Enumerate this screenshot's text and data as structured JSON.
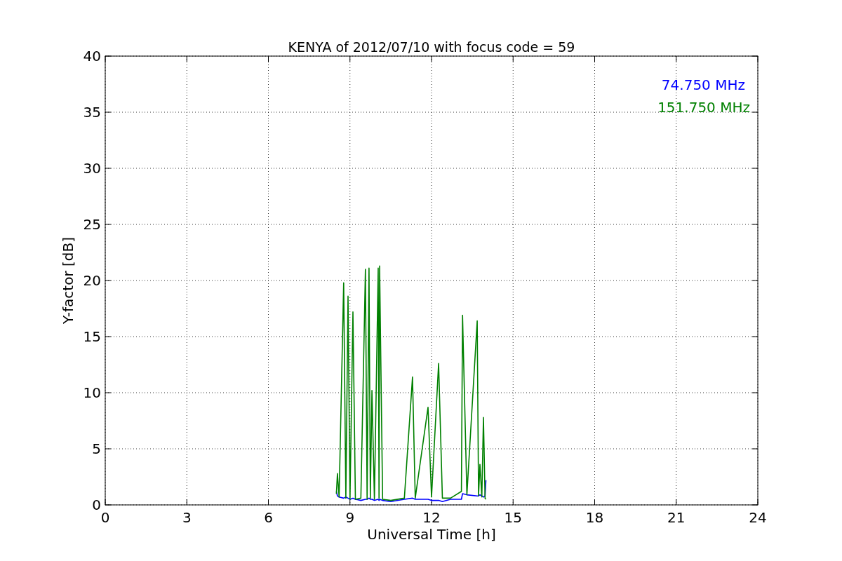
{
  "figure": {
    "chart_data": {
      "type": "line",
      "title": "KENYA of 2012/07/10 with focus code = 59",
      "xlabel": "Universal Time [h]",
      "ylabel": "Y-factor [dB]",
      "x": [
        8.5,
        8.54,
        8.6,
        8.77,
        8.85,
        8.93,
        9.0,
        9.11,
        9.2,
        9.4,
        9.57,
        9.63,
        9.7,
        9.75,
        9.81,
        9.9,
        10.04,
        10.07,
        10.09,
        10.2,
        10.5,
        11.0,
        11.3,
        11.4,
        11.87,
        12.0,
        12.26,
        12.4,
        12.7,
        13.1,
        13.14,
        13.3,
        13.68,
        13.73,
        13.78,
        13.85,
        13.91,
        13.97,
        14.0
      ],
      "series": [
        {
          "name": "74.750 MHz",
          "color": "#0000ff",
          "values": [
            1.2,
            0.8,
            0.7,
            0.6,
            0.7,
            0.6,
            0.5,
            0.6,
            0.5,
            0.4,
            0.5,
            0.5,
            0.6,
            0.5,
            0.5,
            0.4,
            0.5,
            0.4,
            0.5,
            0.4,
            0.3,
            0.5,
            0.6,
            0.5,
            0.5,
            0.4,
            0.4,
            0.3,
            0.5,
            0.5,
            1.0,
            0.9,
            0.8,
            0.8,
            0.9,
            0.8,
            0.7,
            0.8,
            2.2
          ]
        },
        {
          "name": "151.750 MHz",
          "color": "#008000",
          "values": [
            1.0,
            2.8,
            0.7,
            19.8,
            0.6,
            18.6,
            0.5,
            17.2,
            0.5,
            0.6,
            21.0,
            0.5,
            21.1,
            0.6,
            10.2,
            0.5,
            21.1,
            0.6,
            21.3,
            0.5,
            0.4,
            0.6,
            11.4,
            0.6,
            8.7,
            0.7,
            12.6,
            0.6,
            0.6,
            1.2,
            16.9,
            0.9,
            16.4,
            0.8,
            3.6,
            0.7,
            7.8,
            0.6,
            0.5
          ]
        }
      ],
      "grid": true,
      "xlim": [
        0,
        24
      ],
      "ylim": [
        0,
        40
      ],
      "xticks": [
        0,
        3,
        6,
        9,
        12,
        15,
        18,
        21,
        24
      ],
      "yticks": [
        0,
        5,
        10,
        15,
        20,
        25,
        30,
        35,
        40
      ]
    }
  }
}
